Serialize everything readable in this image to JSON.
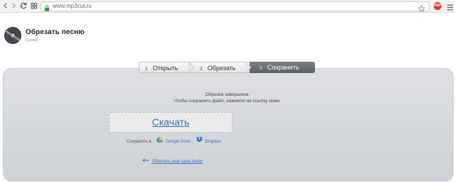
{
  "browser": {
    "url": "www.mp3cut.ru",
    "extension_label": "ABP"
  },
  "header": {
    "title": "Обрезать песню",
    "subtitle": "Онлайн"
  },
  "steps": [
    {
      "number": "1",
      "label": "Открыть"
    },
    {
      "number": "2",
      "label": "Обрезать"
    },
    {
      "number": "3",
      "label": "Сохранить",
      "active": true
    }
  ],
  "content": {
    "message_line1": "Обрезка завершена.",
    "message_line2": "Чтобы сохранить файл, нажмите на ссылку ниже.",
    "download_label": "Скачать",
    "save_to_label": "Сохранить в",
    "google_drive_label": "Google Drive",
    "dropbox_label": "Dropbox",
    "cut_another_label": "Обрезать еще один файл"
  },
  "colors": {
    "accent_link": "#3b73b9",
    "active_step_bg": "#5d6168",
    "panel_bg": "#d3d6db"
  }
}
